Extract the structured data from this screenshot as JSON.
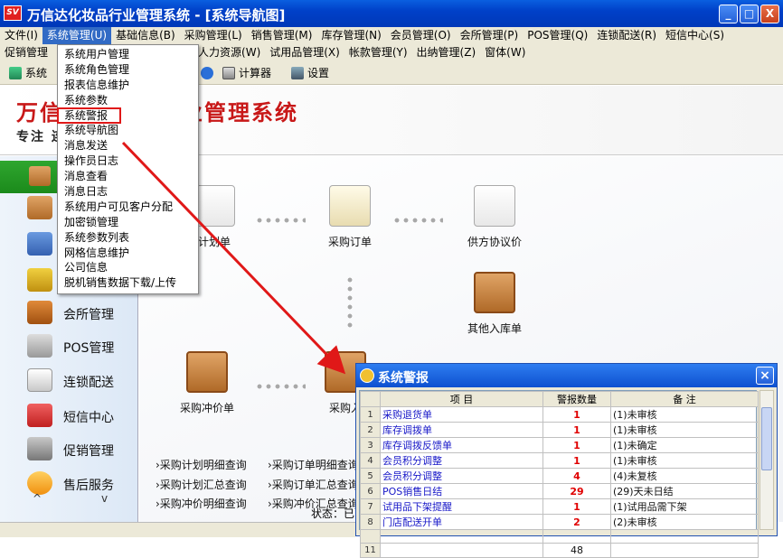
{
  "window": {
    "title": "万信达化妆品行业管理系统 - [系统导航图]",
    "app_icon": "SV",
    "controls": [
      "_",
      "□",
      "X"
    ]
  },
  "menu": {
    "row1": [
      "文件(I)",
      "系统管理(U)",
      "基础信息(B)",
      "采购管理(L)",
      "销售管理(M)",
      "库存管理(N)",
      "会员管理(O)",
      "会所管理(P)",
      "POS管理(Q)",
      "连锁配送(R)",
      "短信中心(S)"
    ],
    "row2": [
      "促销管理",
      "人力资源(W)",
      "试用品管理(X)",
      "帐款管理(Y)",
      "出纳管理(Z)",
      "窗体(W)"
    ]
  },
  "toolbar": {
    "item1": "系统",
    "calculator": "计算器",
    "settings": "设置"
  },
  "banner": {
    "title": "万信达化妆品行业管理系统",
    "subtitle": "专注   连锁   商贸   电商"
  },
  "dropdown": [
    "系统用户管理",
    "系统角色管理",
    "报表信息维护",
    "系统参数",
    "系统警报",
    "系统导航图",
    "消息发送",
    "操作员日志",
    "消息查看",
    "消息日志",
    "系统用户可见客户分配",
    "加密锁管理",
    "系统参数列表",
    "网格信息维护",
    "公司信息",
    "脱机销售数据下载/上传"
  ],
  "sidebar": [
    "会所管理",
    "POS管理",
    "连锁配送",
    "短信中心",
    "促销管理",
    "售后服务"
  ],
  "sidebar_arrows": [
    "^",
    "v"
  ],
  "nodes": {
    "plan": "计划单",
    "order": "采购订单",
    "price": "供方协议价",
    "other_in": "其他入库单",
    "offset": "采购冲价单",
    "in": "采购入"
  },
  "links": [
    [
      "›采购计划明细查询",
      "›采购订单明细查询"
    ],
    [
      "›采购计划汇总查询",
      "›采购订单汇总查询"
    ],
    [
      "›采购冲价明细查询",
      "›采购冲价汇总查询"
    ]
  ],
  "status": "状态：已",
  "alert": {
    "title": "系统警报",
    "headers": {
      "item": "项    目",
      "count": "警报数量",
      "note": "备    注"
    },
    "rows": [
      {
        "no": "1",
        "item": "采购退货单",
        "count": "1",
        "note": "(1)未审核"
      },
      {
        "no": "2",
        "item": "库存调拨单",
        "count": "1",
        "note": "(1)未审核"
      },
      {
        "no": "3",
        "item": "库存调拨反馈单",
        "count": "1",
        "note": "(1)未确定"
      },
      {
        "no": "4",
        "item": "会员积分调整",
        "count": "1",
        "note": "(1)未审核"
      },
      {
        "no": "5",
        "item": "会员积分调整",
        "count": "4",
        "note": "(4)未复核"
      },
      {
        "no": "6",
        "item": "POS销售日结",
        "count": "29",
        "note": "(29)天未日结"
      },
      {
        "no": "7",
        "item": "试用品下架提醒",
        "count": "1",
        "note": "(1)试用品需下架"
      },
      {
        "no": "8",
        "item": "门店配送开单",
        "count": "2",
        "note": "(2)未审核"
      }
    ],
    "total_no": "11",
    "total": "48"
  },
  "colors": {
    "title_blue": "#0040c8",
    "alert_red": "#e00000",
    "link_blue": "#1818c8",
    "brand_red": "#c81818"
  }
}
